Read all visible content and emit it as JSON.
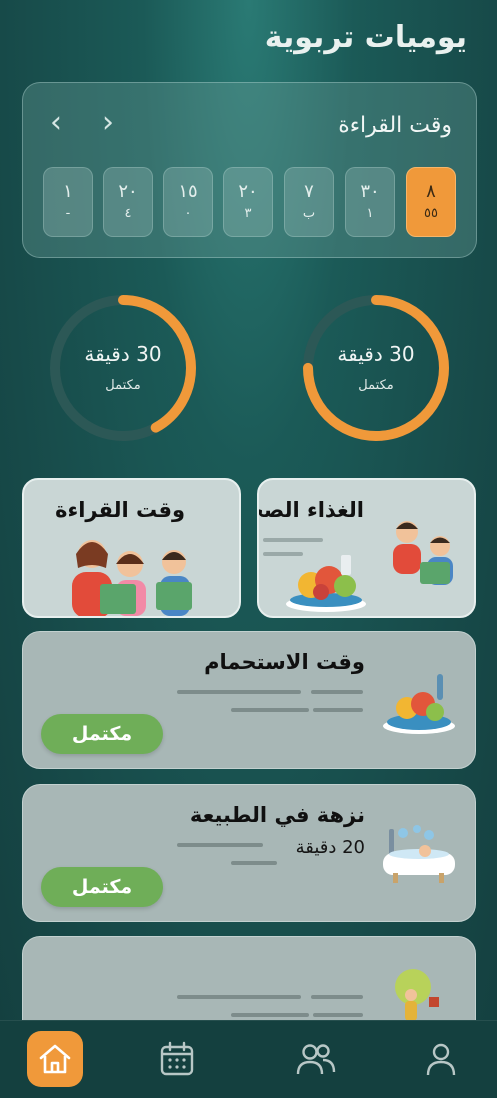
{
  "header": {
    "title": "يوميات تربوية"
  },
  "calendar": {
    "title": "وقت القراءة",
    "days": [
      {
        "top": "٨",
        "bottom": "٥٥",
        "active": true
      },
      {
        "top": "٣٠",
        "bottom": "١",
        "active": false
      },
      {
        "top": "٧",
        "bottom": "ب",
        "active": false
      },
      {
        "top": "٢٠",
        "bottom": "٣",
        "active": false
      },
      {
        "top": "١٥",
        "bottom": "٠",
        "active": false
      },
      {
        "top": "٢٠",
        "bottom": "٤",
        "active": false
      },
      {
        "top": "١",
        "bottom": "-",
        "active": false
      }
    ]
  },
  "rings": [
    {
      "value": "30 دقيقة",
      "status": "مكتمل",
      "progress": 0.75
    },
    {
      "value": "30 دقيقة",
      "status": "مكتمل",
      "progress": 0.42
    }
  ],
  "features": [
    {
      "title": "الغذاء الصحي"
    },
    {
      "title": "وقت القراءة"
    }
  ],
  "activities": [
    {
      "title": "وقت الاستحمام",
      "subtitle": "",
      "status": "مكتمل"
    },
    {
      "title": "نزهة في الطبيعة",
      "subtitle": "20 دقيقة",
      "status": "مكتمل"
    }
  ],
  "colors": {
    "accent": "#f0993a",
    "success": "#6fae58",
    "background": "#174a49"
  },
  "nav": [
    "home-icon",
    "calendar-icon",
    "group-icon",
    "profile-icon"
  ]
}
